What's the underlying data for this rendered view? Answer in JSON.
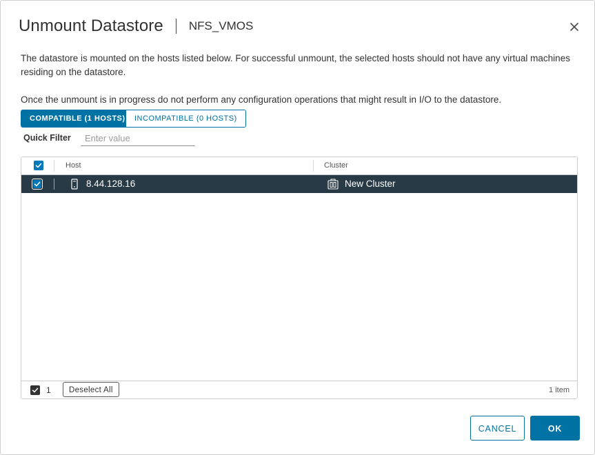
{
  "dialog": {
    "title": "Unmount Datastore",
    "subtitle": "NFS_VMOS",
    "description_1": "The datastore is mounted on the hosts listed below. For successful unmount, the selected hosts should not have any virtual machines residing on the datastore.",
    "description_2": "Once the unmount is in progress do not perform any configuration operations that might result in I/O to the datastore."
  },
  "tabs": [
    {
      "label": "COMPATIBLE (1 HOSTS)",
      "active": true
    },
    {
      "label": "INCOMPATIBLE (0 HOSTS)",
      "active": false
    }
  ],
  "quick_filter": {
    "label": "Quick Filter",
    "placeholder": "Enter value",
    "value": ""
  },
  "grid": {
    "columns": [
      "Host",
      "Cluster"
    ],
    "rows": [
      {
        "host": "8.44.128.16",
        "cluster": "New Cluster",
        "selected": true,
        "host_icon": "host-icon",
        "cluster_icon": "cluster-icon"
      }
    ],
    "footer": {
      "selected_count": "1",
      "deselect_label": "Deselect All",
      "items_label": "1 item"
    }
  },
  "buttons": {
    "cancel": "CANCEL",
    "ok": "OK"
  },
  "colors": {
    "accent": "#0072a3",
    "selected_row": "#283a46"
  }
}
